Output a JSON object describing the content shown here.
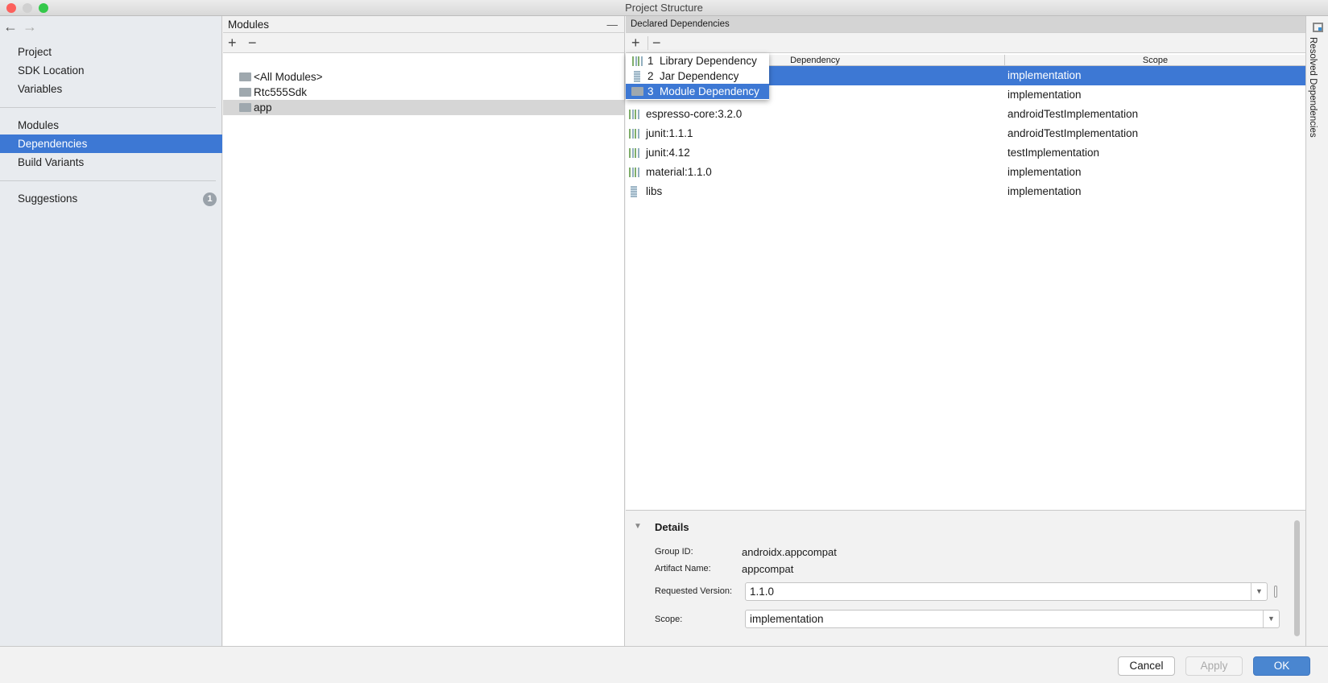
{
  "window": {
    "title": "Project Structure"
  },
  "nav": {
    "back_icon": "arrow-left-icon",
    "forward_icon": "arrow-right-icon",
    "items": [
      {
        "label": "Project"
      },
      {
        "label": "SDK Location"
      },
      {
        "label": "Variables"
      },
      {
        "label": "Modules"
      },
      {
        "label": "Dependencies",
        "selected": true
      },
      {
        "label": "Build Variants"
      },
      {
        "label": "Suggestions",
        "badge": "1"
      }
    ]
  },
  "modules": {
    "title": "Modules",
    "add": "+",
    "remove": "−",
    "collapse": "—",
    "items": [
      {
        "label": "<All Modules>"
      },
      {
        "label": "Rtc555Sdk"
      },
      {
        "label": "app",
        "selected": true
      }
    ]
  },
  "deps": {
    "title": "Declared Dependencies",
    "add": "+",
    "remove": "−",
    "columns": [
      "Dependency",
      "Scope"
    ],
    "rows": [
      {
        "name": "",
        "scope": "implementation",
        "icon": "library"
      },
      {
        "name": "",
        "scope": "implementation",
        "icon": "library"
      },
      {
        "name": "espresso-core:3.2.0",
        "scope": "androidTestImplementation",
        "icon": "library"
      },
      {
        "name": "junit:1.1.1",
        "scope": "androidTestImplementation",
        "icon": "library"
      },
      {
        "name": "junit:4.12",
        "scope": "testImplementation",
        "icon": "library"
      },
      {
        "name": "material:1.1.0",
        "scope": "implementation",
        "icon": "library"
      },
      {
        "name": "libs",
        "scope": "implementation",
        "icon": "jar"
      }
    ],
    "popup": [
      {
        "num": "1",
        "label": "Library Dependency"
      },
      {
        "num": "2",
        "label": "Jar Dependency"
      },
      {
        "num": "3",
        "label": "Module Dependency",
        "selected": true
      }
    ]
  },
  "details": {
    "title": "Details",
    "group_label": "Group ID:",
    "group": "androidx.appcompat",
    "artifact_label": "Artifact Name:",
    "artifact": "appcompat",
    "version_label": "Requested Version:",
    "version": "1.1.0",
    "scope_label": "Scope:",
    "scope": "implementation"
  },
  "right_strip": {
    "label": "Resolved Dependencies"
  },
  "buttons": {
    "cancel": "Cancel",
    "apply": "Apply",
    "ok": "OK"
  },
  "colors": {
    "accent": "#3d78d4",
    "sidebar": "#e8ebef"
  }
}
